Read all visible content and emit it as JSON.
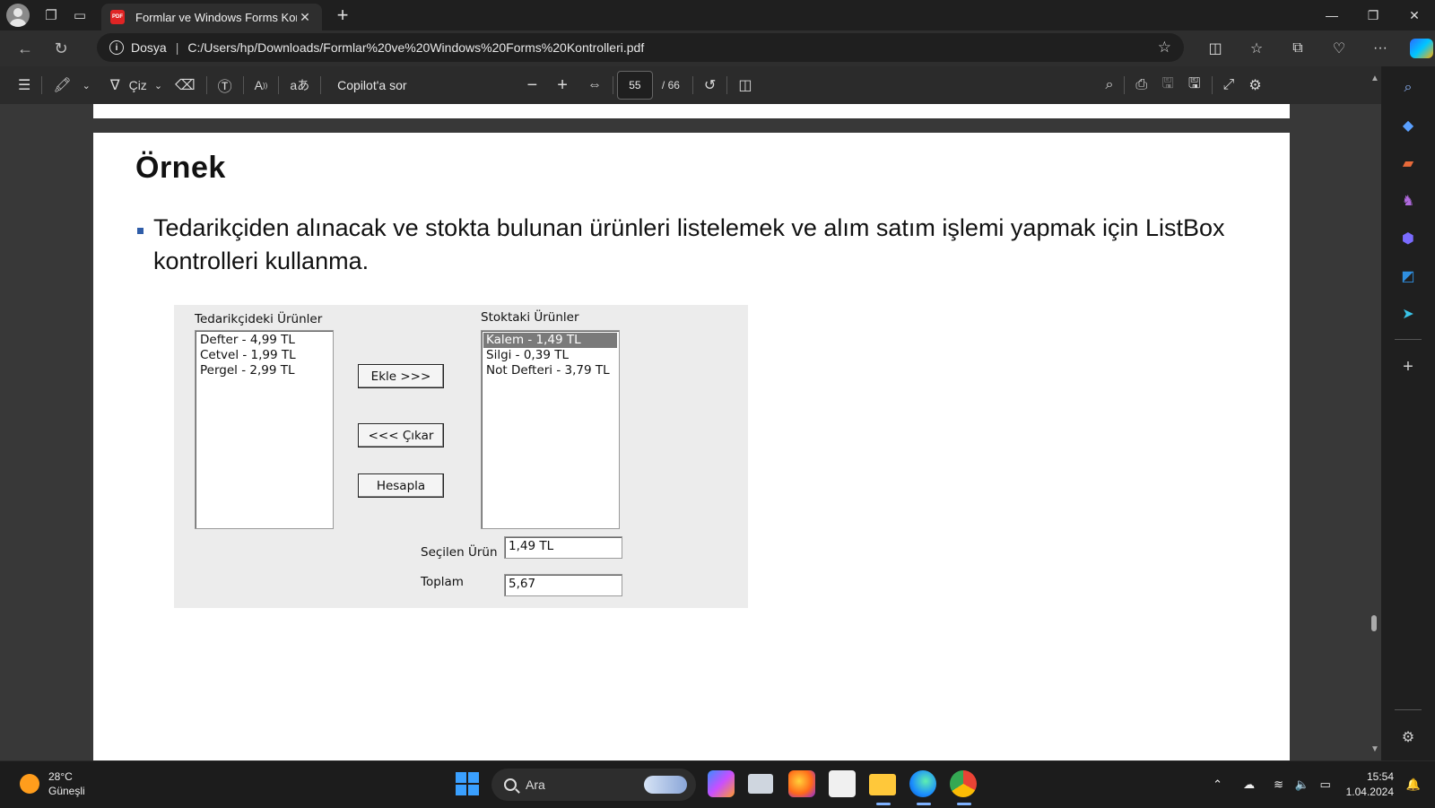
{
  "browser": {
    "tab_title": "Formlar ve Windows Forms Kontr",
    "pdf_badge": "PDF",
    "address_label": "Dosya",
    "address_url": "C:/Users/hp/Downloads/Formlar%20ve%20Windows%20Forms%20Kontrolleri.pdf"
  },
  "pdf_toolbar": {
    "draw_label": "Çiz",
    "copilot_label": "Copilot'a sor",
    "page_current": "55",
    "page_total": "/ 66"
  },
  "document": {
    "title": "Örnek",
    "bullet_text": "Tedarikçiden alınacak ve stokta bulunan ürünleri listelemek ve alım satım işlemi yapmak için ListBox kontrolleri kullanma."
  },
  "form": {
    "supplier_label": "Tedarikçideki Ürünler",
    "supplier_items": [
      "Defter - 4,99 TL",
      "Cetvel - 1,99 TL",
      "Pergel - 2,99 TL"
    ],
    "stock_label": "Stoktaki Ürünler",
    "stock_items": [
      "Kalem - 1,49 TL",
      "Silgi - 0,39 TL",
      "Not Defteri - 3,79 TL"
    ],
    "stock_selected_index": 0,
    "add_button": "Ekle >>>",
    "remove_button": "<<< Çıkar",
    "calc_button": "Hesapla",
    "selected_label": "Seçilen Ürün",
    "selected_value": "1,49 TL",
    "total_label": "Toplam",
    "total_value": "5,67"
  },
  "taskbar": {
    "temperature": "28°C",
    "weather": "Güneşli",
    "search_placeholder": "Ara",
    "time": "15:54",
    "date": "1.04.2024"
  },
  "colors": {
    "accent": "#3aa0ff",
    "bullet": "#2f5da8",
    "pdf_red": "#e02424"
  }
}
